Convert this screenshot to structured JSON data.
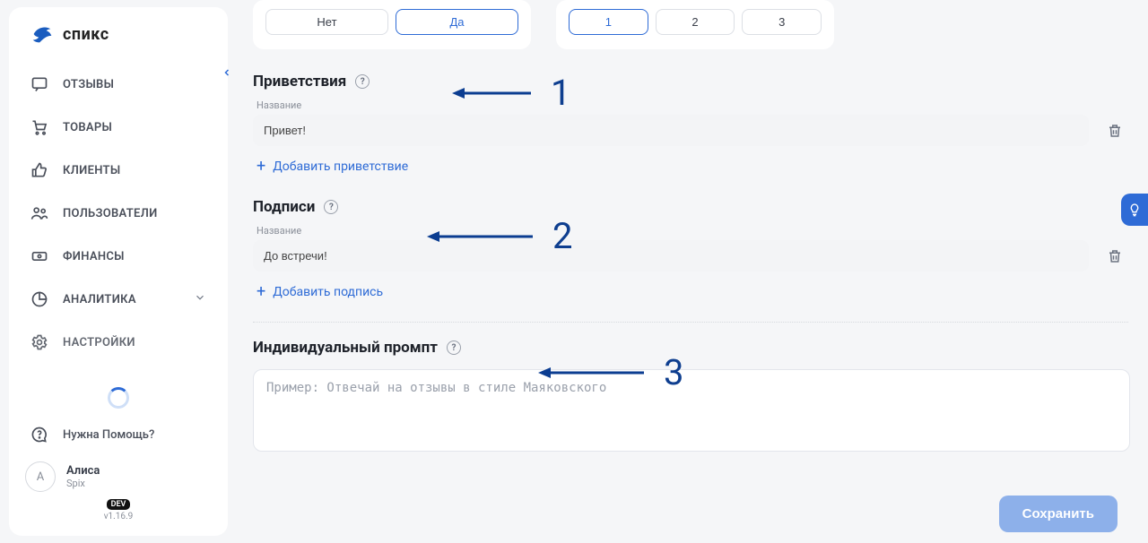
{
  "brand": {
    "name": "спикс"
  },
  "sidebar": {
    "items": [
      {
        "label": "ОТЗЫВЫ"
      },
      {
        "label": "ТОВАРЫ"
      },
      {
        "label": "КЛИЕНТЫ"
      },
      {
        "label": "ПОЛЬЗОВАТЕЛИ"
      },
      {
        "label": "ФИНАНСЫ"
      },
      {
        "label": "АНАЛИТИКА"
      },
      {
        "label": "НАСТРОЙКИ"
      }
    ],
    "help_label": "Нужна Помощь?",
    "user": {
      "name": "Алиса",
      "org": "Spix",
      "initial": "А"
    },
    "dev_badge": "DEV",
    "version": "v1.16.9"
  },
  "cardA": {
    "pills": [
      "Нет",
      "Да"
    ],
    "selected": "Да"
  },
  "cardB": {
    "pills": [
      "1",
      "2",
      "3"
    ],
    "selected": "1"
  },
  "greetings": {
    "heading": "Приветствия",
    "field_label": "Название",
    "value": "Привет!",
    "add_label": "Добавить приветствие"
  },
  "signatures": {
    "heading": "Подписи",
    "field_label": "Название",
    "value": "До встречи!",
    "add_label": "Добавить подпись"
  },
  "prompt": {
    "heading": "Индивидуальный промпт",
    "placeholder": "Пример: Отвечай на отзывы в стиле Маяковского"
  },
  "save_label": "Сохранить",
  "annotations": {
    "a1": "1",
    "a2": "2",
    "a3": "3"
  }
}
